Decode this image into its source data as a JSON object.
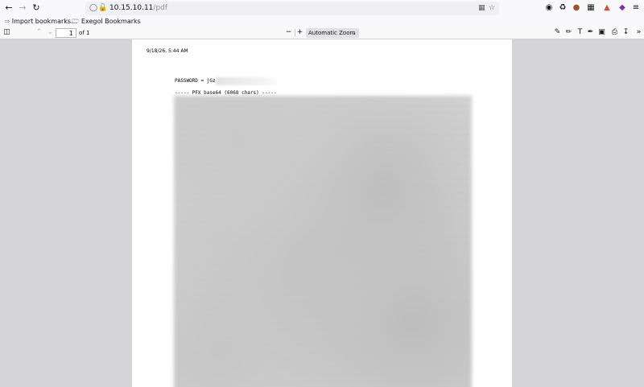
{
  "browser": {
    "url_host": "10.15.10.11",
    "url_path": "/pdf",
    "icons": {
      "back": "back-arrow-icon",
      "forward": "forward-arrow-icon",
      "reload": "reload-icon",
      "shield": "tracking-shield-icon",
      "lock": "insecure-lock-icon",
      "qr": "qr-code-icon",
      "bookmark_star": "bookmark-star-icon"
    }
  },
  "bookmarks": {
    "import_label": "Import bookmarks...",
    "folder_label": "Exegol Bookmarks"
  },
  "pdf_toolbar": {
    "page_number": "1",
    "page_total": "of 1",
    "zoom_value": "Automatic Zoom"
  },
  "document": {
    "print_date": "9/18/26, 5:44 AM",
    "password_label": "PASSWORD = jGz",
    "pfx_header": "----- PFX base64 (6068 chars) -----"
  },
  "colors": {
    "chrome_bg": "#f9f9fb",
    "viewer_bg": "#d4d4d7",
    "page_bg": "#ffffff"
  }
}
